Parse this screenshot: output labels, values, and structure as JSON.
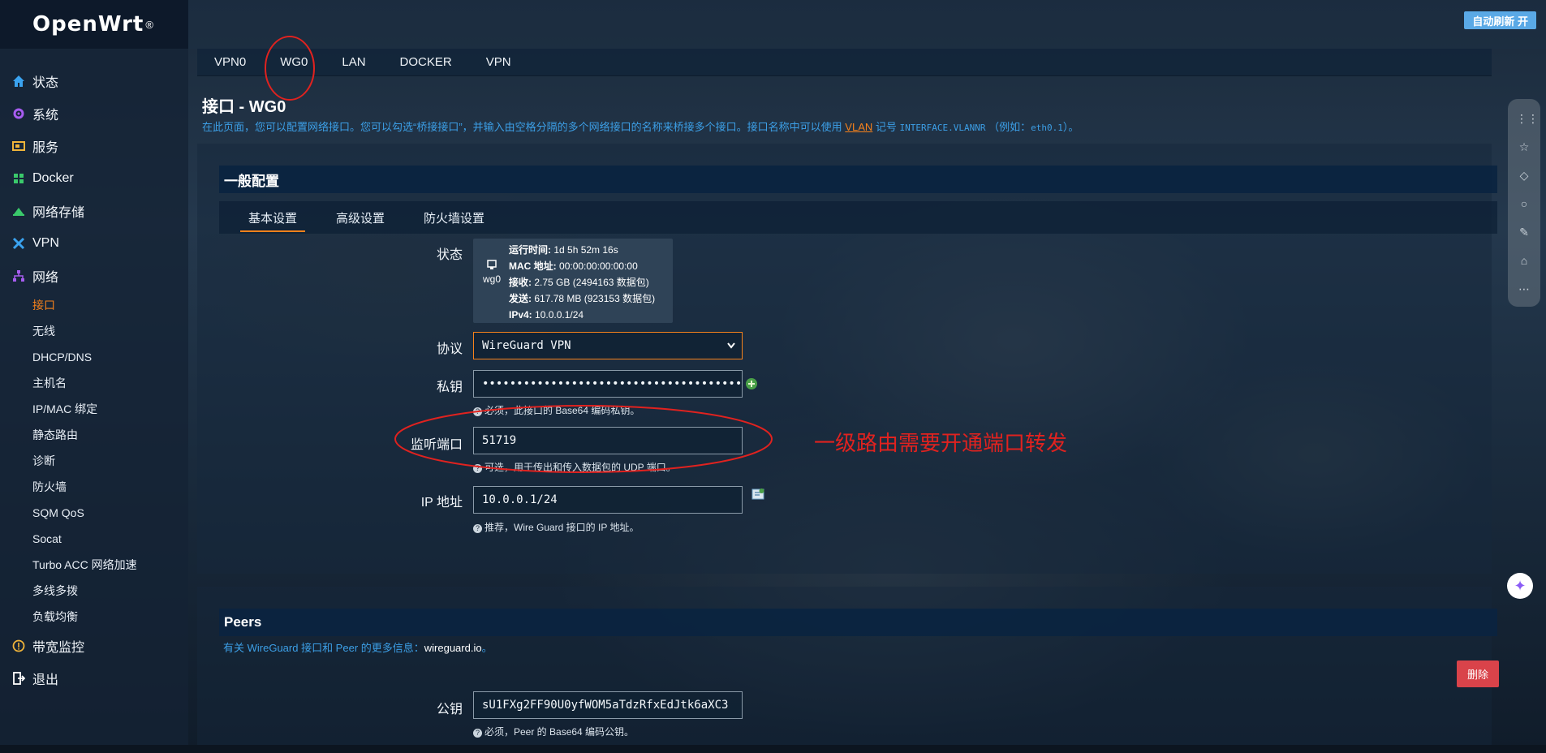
{
  "brand": {
    "name": "OpenWrt",
    "mark": "®"
  },
  "topbar": {
    "auto_refresh": "自动刷新 开"
  },
  "sidebar": {
    "items": [
      {
        "label": "状态",
        "icon": "home-icon",
        "color": "#3aa3f0"
      },
      {
        "label": "系统",
        "icon": "gear-icon",
        "color": "#a75cf0"
      },
      {
        "label": "服务",
        "icon": "services-icon",
        "color": "#f0b43a"
      },
      {
        "label": "Docker",
        "icon": "docker-icon",
        "color": "#3ac96b"
      },
      {
        "label": "网络存储",
        "icon": "storage-icon",
        "color": "#3ac96b"
      },
      {
        "label": "VPN",
        "icon": "vpn-icon",
        "color": "#3aa3f0"
      },
      {
        "label": "网络",
        "icon": "network-icon",
        "color": "#a75cf0"
      }
    ],
    "network_sub": [
      "接口",
      "无线",
      "DHCP/DNS",
      "主机名",
      "IP/MAC 绑定",
      "静态路由",
      "诊断",
      "防火墙",
      "SQM QoS",
      "Socat",
      "Turbo ACC 网络加速",
      "多线多拨",
      "负载均衡"
    ],
    "bottom": [
      {
        "label": "带宽监控",
        "icon": "bandwidth-icon",
        "color": "#f0b43a"
      },
      {
        "label": "退出",
        "icon": "logout-icon",
        "color": "#ffffff"
      }
    ]
  },
  "iface_tabs": [
    "VPN0",
    "WG0",
    "LAN",
    "DOCKER",
    "VPN"
  ],
  "page": {
    "title": "接口 - WG0",
    "desc_prefix": "在此页面，您可以配置网络接口。您可以勾选“桥接接口”，并输入由空格分隔的多个网络接口的名称来桥接多个接口。接口名称中可以使用",
    "desc_vlan": "VLAN",
    "desc_mid": "记号",
    "desc_code1": "INTERFACE.VLANNR",
    "desc_paren": "（例如：",
    "desc_code2": "eth0.1",
    "desc_suffix": "）。"
  },
  "general": {
    "title": "一般配置",
    "tabs": [
      "基本设置",
      "高级设置",
      "防火墙设置"
    ],
    "status": {
      "label": "状态",
      "iface": "wg0",
      "uptime_label": "运行时间:",
      "uptime": "1d 5h 52m 16s",
      "mac_label": "MAC 地址:",
      "mac": "00:00:00:00:00:00",
      "rx_label": "接收:",
      "rx": "2.75 GB (2494163 数据包)",
      "tx_label": "发送:",
      "tx": "617.78 MB (923153 数据包)",
      "ipv4_label": "IPv4:",
      "ipv4": "10.0.0.1/24"
    },
    "protocol": {
      "label": "协议",
      "value": "WireGuard VPN"
    },
    "private_key": {
      "label": "私钥",
      "value": "••••••••••••••••••••••••••••••••••••••••",
      "hint": "必须，此接口的 Base64 编码私钥。"
    },
    "listen_port": {
      "label": "监听端口",
      "value": "51719",
      "hint": "可选，用于传出和传入数据包的 UDP 端口。"
    },
    "ip_address": {
      "label": "IP 地址",
      "value": "10.0.0.1/24",
      "hint": "推荐，Wire Guard 接口的 IP 地址。"
    }
  },
  "annotation": {
    "text": "一级路由需要开通端口转发",
    "color": "#e0221f"
  },
  "peers": {
    "title": "Peers",
    "desc": "有关 WireGuard 接口和 Peer 的更多信息：",
    "link": "wireguard.io",
    "link_suffix": "。",
    "delete": "删除",
    "public_key": {
      "label": "公钥",
      "value": "sU1FXg2FF90U0yfWOM5aTdzRfxEdJtk6aXC3",
      "hint": "必须，Peer 的 Base64 编码公钥。"
    }
  }
}
